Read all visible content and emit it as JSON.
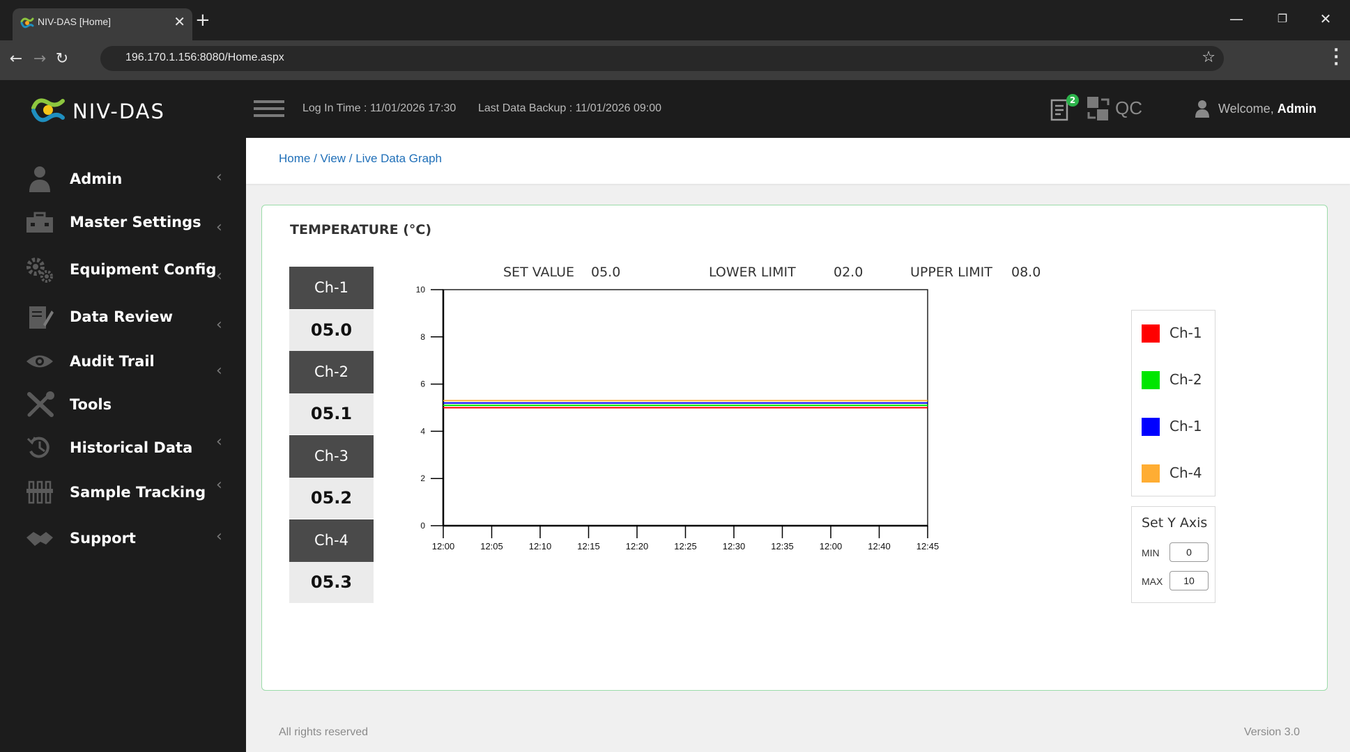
{
  "browser": {
    "tab_title": "NIV-DAS [Home]",
    "url": "196.170.1.156:8080/Home.aspx"
  },
  "header": {
    "brand": "NIV-DAS",
    "login_time": "Log In Time : 11/01/2026 17:30",
    "last_backup": "Last Data Backup : 11/01/2026 09:00",
    "notification_count": "2",
    "qc_label": "QC",
    "welcome_prefix": "Welcome,",
    "user_name": "Admin"
  },
  "sidebar": {
    "items": [
      {
        "label": "Admin",
        "icon": "user-icon"
      },
      {
        "label": "Master Settings",
        "icon": "toolbox-icon"
      },
      {
        "label": "Equipment Config",
        "icon": "gears-icon"
      },
      {
        "label": "Data Review",
        "icon": "edit-document-icon"
      },
      {
        "label": "Audit Trail",
        "icon": "eye-icon"
      },
      {
        "label": "Tools",
        "icon": "tools-icon"
      },
      {
        "label": "Historical Data",
        "icon": "history-icon"
      },
      {
        "label": "Sample Tracking",
        "icon": "test-tubes-icon"
      },
      {
        "label": "Support",
        "icon": "handshake-icon"
      }
    ]
  },
  "breadcrumb": "Home / View / Live Data Graph",
  "panel": {
    "title": "TEMPERATURE (°C)",
    "set_value_label": "SET VALUE",
    "set_value": "05.0",
    "lower_limit_label": "LOWER LIMIT",
    "lower_limit": "02.0",
    "upper_limit_label": "UPPER LIMIT",
    "upper_limit": "08.0",
    "channels": [
      {
        "label": "Ch-1",
        "value": "05.0"
      },
      {
        "label": "Ch-2",
        "value": "05.1"
      },
      {
        "label": "Ch-3",
        "value": "05.2"
      },
      {
        "label": "Ch-4",
        "value": "05.3"
      }
    ],
    "legend": [
      {
        "label": "Ch-1",
        "color": "#ff0000"
      },
      {
        "label": "Ch-2",
        "color": "#00e600"
      },
      {
        "label": "Ch-1",
        "color": "#0000ff"
      },
      {
        "label": "Ch-4",
        "color": "#ffad33"
      }
    ],
    "y_axis": {
      "title": "Set Y Axis",
      "min_label": "MIN",
      "min_value": "0",
      "max_label": "MAX",
      "max_value": "10"
    }
  },
  "chart_data": {
    "type": "line",
    "title": "",
    "xlabel": "",
    "ylabel": "",
    "ylim": [
      0,
      10
    ],
    "y_ticks": [
      0,
      2,
      4,
      6,
      8,
      10
    ],
    "x": [
      "12:00",
      "12:05",
      "12:10",
      "12:15",
      "12:20",
      "12:25",
      "12:30",
      "12:35",
      "12:00",
      "12:40",
      "12:45"
    ],
    "series": [
      {
        "color": "#ff0000",
        "values": [
          5.0,
          5.0,
          5.0,
          5.0,
          5.0,
          5.0,
          5.0,
          5.0,
          5.0,
          5.0,
          5.0
        ]
      },
      {
        "color": "#00e600",
        "values": [
          5.1,
          5.1,
          5.1,
          5.1,
          5.1,
          5.1,
          5.1,
          5.1,
          5.1,
          5.1,
          5.1
        ]
      },
      {
        "color": "#0000ff",
        "values": [
          5.2,
          5.2,
          5.2,
          5.2,
          5.2,
          5.2,
          5.2,
          5.2,
          5.2,
          5.2,
          5.2
        ]
      },
      {
        "color": "#ffad33",
        "values": [
          5.3,
          5.3,
          5.3,
          5.3,
          5.3,
          5.3,
          5.3,
          5.3,
          5.3,
          5.3,
          5.3
        ]
      }
    ],
    "grid": false,
    "legend_position": "right"
  },
  "footer": {
    "left": "All rights reserved",
    "right": "Version 3.0"
  }
}
